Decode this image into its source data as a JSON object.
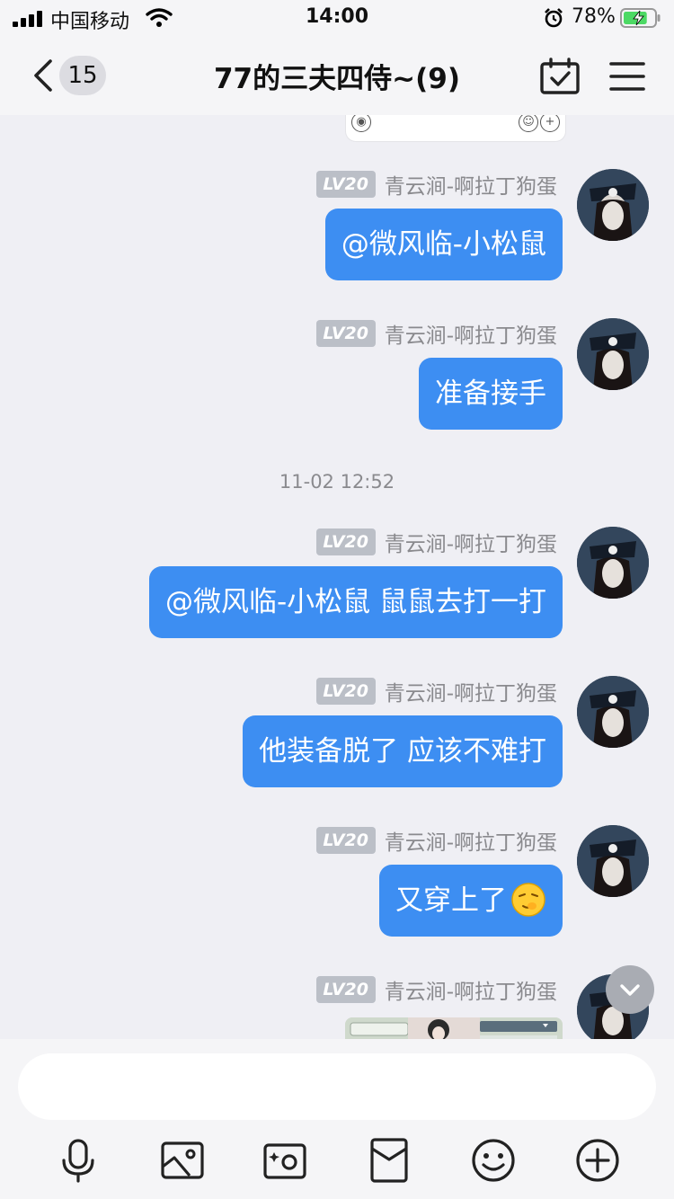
{
  "status_bar": {
    "carrier": "中国移动",
    "time": "14:00",
    "battery_percent": "78%",
    "battery_level": 0.78,
    "battery_charging": true
  },
  "nav": {
    "unread_count": "15",
    "title": "77的三夫四侍~(9)"
  },
  "messages": [
    {
      "level": "LV20",
      "sender": "青云涧-啊拉丁狗蛋",
      "text": "@微风临-小松鼠"
    },
    {
      "level": "LV20",
      "sender": "青云涧-啊拉丁狗蛋",
      "text": "准备接手"
    },
    {
      "timestamp": "11-02 12:52"
    },
    {
      "level": "LV20",
      "sender": "青云涧-啊拉丁狗蛋",
      "text": "@微风临-小松鼠 鼠鼠去打一打"
    },
    {
      "level": "LV20",
      "sender": "青云涧-啊拉丁狗蛋",
      "text": "他装备脱了 应该不难打"
    },
    {
      "level": "LV20",
      "sender": "青云涧-啊拉丁狗蛋",
      "text": "又穿上了",
      "emoji": "smirk-face-emoji"
    },
    {
      "level": "LV20",
      "sender": "青云涧-啊拉丁狗蛋",
      "image": "game-screenshot-preview"
    }
  ],
  "input": {
    "placeholder": ""
  },
  "toolbar": [
    "microphone-icon",
    "photo-icon",
    "camera-icon",
    "red-packet-icon",
    "emoji-icon",
    "plus-icon"
  ],
  "colors": {
    "bubble": "#3d8ef2",
    "background": "#efeff4",
    "level_badge": "#bbbfc7"
  }
}
